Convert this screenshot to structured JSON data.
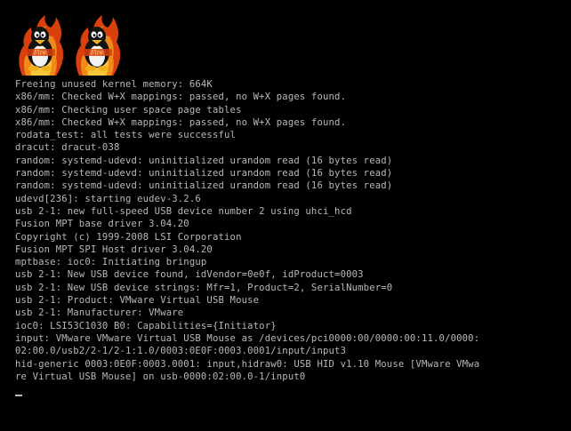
{
  "boot_logo": {
    "icon": "tux-penguin-on-fire-icon",
    "count": 2,
    "label": "Fire"
  },
  "console": {
    "text_color": "#b8b8b8",
    "background_color": "#000000",
    "lines": [
      "Freeing unused kernel memory: 664K",
      "x86/mm: Checked W+X mappings: passed, no W+X pages found.",
      "x86/mm: Checking user space page tables",
      "x86/mm: Checked W+X mappings: passed, no W+X pages found.",
      "rodata_test: all tests were successful",
      "dracut: dracut-038",
      "random: systemd-udevd: uninitialized urandom read (16 bytes read)",
      "random: systemd-udevd: uninitialized urandom read (16 bytes read)",
      "random: systemd-udevd: uninitialized urandom read (16 bytes read)",
      "udevd[236]: starting eudev-3.2.6",
      "usb 2-1: new full-speed USB device number 2 using uhci_hcd",
      "Fusion MPT base driver 3.04.20",
      "Copyright (c) 1999-2008 LSI Corporation",
      "Fusion MPT SPI Host driver 3.04.20",
      "mptbase: ioc0: Initiating bringup",
      "usb 2-1: New USB device found, idVendor=0e0f, idProduct=0003",
      "usb 2-1: New USB device strings: Mfr=1, Product=2, SerialNumber=0",
      "usb 2-1: Product: VMware Virtual USB Mouse",
      "usb 2-1: Manufacturer: VMware",
      "ioc0: LSI53C1030 B0: Capabilities={Initiator}",
      "input: VMware VMware Virtual USB Mouse as /devices/pci0000:00/0000:00:11.0/0000:",
      "02:00.0/usb2/2-1/2-1:1.0/0003:0E0F:0003.0001/input/input3",
      "hid-generic 0003:0E0F:0003.0001: input,hidraw0: USB HID v1.10 Mouse [VMware VMwa",
      "re Virtual USB Mouse] on usb-0000:02:00.0-1/input0"
    ]
  },
  "cursor": {
    "symbol": "_"
  }
}
